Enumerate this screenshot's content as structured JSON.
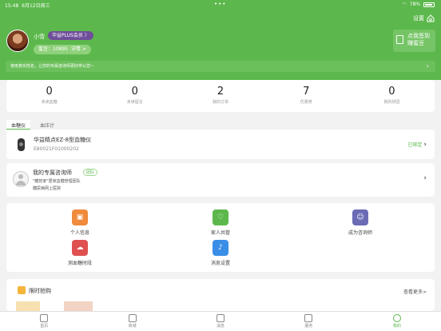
{
  "status_bar": {
    "time": "15:48",
    "date": "6月12日周三",
    "battery": "78%"
  },
  "header": {
    "settings_label": "设置",
    "username": "小雪",
    "member_badge": "华益PLUS会员 〉",
    "points_label": "蜜豆：10895",
    "points_detail": "详情 >",
    "signin_line1": "点我签到",
    "signin_line2": "赚蜜豆",
    "notice_text": "使用真实姓名，让您的专属咨询师更好辨认您~"
  },
  "stats": [
    {
      "value": "0",
      "label": "未读血糖"
    },
    {
      "value": "0",
      "label": "未读留言"
    },
    {
      "value": "2",
      "label": "我的订单"
    },
    {
      "value": "7",
      "label": "优惠券"
    },
    {
      "value": "0",
      "label": "我的拼团"
    }
  ],
  "device_tabs": [
    "血糖仪",
    "血压计"
  ],
  "device": {
    "name": "华益精点EZ-8型血糖仪",
    "serial": "E80021F01000202",
    "status": "已绑定"
  },
  "advisor": {
    "title": "我的专属咨询师",
    "tag": "团队",
    "desc1": "\"糖管家\"居家血糖管理团队",
    "desc2": "糖尿病网上医院"
  },
  "menu": [
    {
      "label": "个人信息",
      "icon": "person-card-icon",
      "color": "#f08a3c"
    },
    {
      "label": "家人共管",
      "icon": "heart-icon",
      "color": "#5cb84c"
    },
    {
      "label": "成为咨询师",
      "icon": "advisor-icon",
      "color": "#6b6bb5"
    },
    {
      "label": "测血糖时段",
      "icon": "cloud-clock-icon",
      "color": "#e05050"
    },
    {
      "label": "消息设置",
      "icon": "bell-icon",
      "color": "#3a8ee6"
    }
  ],
  "flash_sale": {
    "title": "限时抢购",
    "more": "查看更多>"
  },
  "tabbar": [
    {
      "label": "首页",
      "active": false
    },
    {
      "label": "商城",
      "active": false
    },
    {
      "label": "消息",
      "active": false
    },
    {
      "label": "服务",
      "active": false
    },
    {
      "label": "我的",
      "active": true
    }
  ]
}
